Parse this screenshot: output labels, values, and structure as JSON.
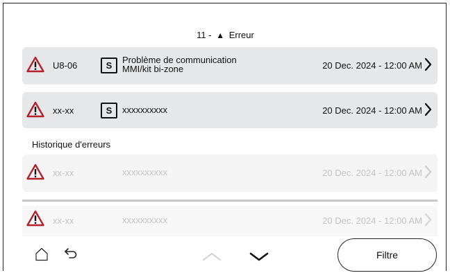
{
  "header": {
    "count": "11 -",
    "title": "Erreur",
    "warn_glyph": "▲"
  },
  "active_errors": [
    {
      "code": "U8-06",
      "badge": "S",
      "description_line1": "Problème de communication",
      "description_line2": "MMI/kit bi-zone",
      "date": "20 Dec. 2024 - 12:00 AM"
    },
    {
      "code": "xx-xx",
      "badge": "S",
      "description_line1": "xxxxxxxxxx",
      "description_line2": "",
      "date": "20 Dec. 2024 - 12:00 AM"
    }
  ],
  "history": {
    "label": "Historique d'erreurs",
    "items": [
      {
        "code": "xx-xx",
        "description": "xxxxxxxxxx",
        "date": "20 Dec. 2024 - 12:00 AM"
      },
      {
        "code": "xx-xx",
        "description": "xxxxxxxxxx",
        "date": "20 Dec. 2024 - 12:00 AM"
      }
    ]
  },
  "bottom_bar": {
    "filter_label": "Filtre",
    "icons": [
      "home-icon",
      "back-icon",
      "chevron-up-icon",
      "chevron-down-icon"
    ]
  },
  "colors": {
    "alert_red": "#b3202a",
    "row_bg": "#e6e7e8",
    "faded_text": "#c3c3c3"
  }
}
